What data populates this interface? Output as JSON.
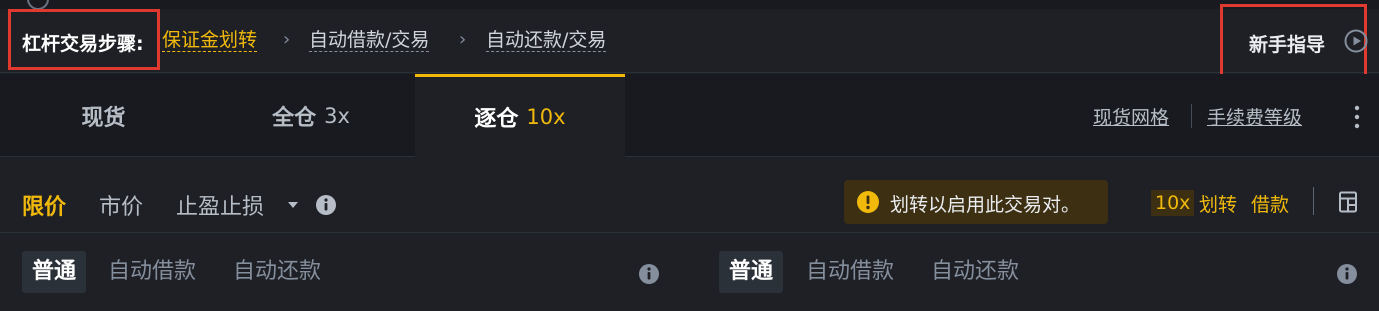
{
  "steps": {
    "label": "杠杆交易步骤:",
    "step1": "保证金划转",
    "step2": "自动借款/交易",
    "step3": "自动还款/交易",
    "separator": "›"
  },
  "guide": {
    "label": "新手指导"
  },
  "tabs": [
    {
      "label": "现货",
      "leverage": ""
    },
    {
      "label": "全仓",
      "leverage": "3x"
    },
    {
      "label": "逐仓",
      "leverage": "10x",
      "active": true
    }
  ],
  "links": {
    "grid": "现货网格",
    "fees": "手续费等级"
  },
  "order_types": {
    "limit": "限价",
    "market": "市价",
    "stop": "止盈止损"
  },
  "warning": {
    "text": "划转以启用此交易对。"
  },
  "actions": {
    "leverage": "10x",
    "transfer": "划转",
    "borrow": "借款"
  },
  "buy_modes": {
    "normal": "普通",
    "auto_borrow": "自动借款",
    "auto_repay": "自动还款"
  },
  "sell_modes": {
    "normal": "普通",
    "auto_borrow": "自动借款",
    "auto_repay": "自动还款"
  },
  "colors": {
    "accent": "#f0b90b",
    "highlight": "#e03a2f",
    "background": "#1e2026"
  }
}
